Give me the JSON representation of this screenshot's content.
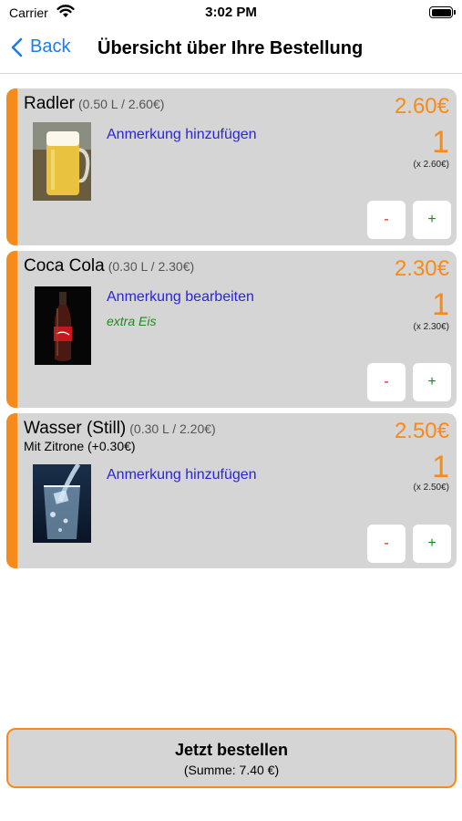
{
  "status_bar": {
    "carrier": "Carrier",
    "time": "3:02 PM"
  },
  "nav": {
    "back_label": "Back",
    "title": "Übersicht über Ihre Bestellung"
  },
  "items": [
    {
      "name": "Radler",
      "meta": "(0.50 L / 2.60€)",
      "extra": "",
      "price": "2.60€",
      "quantity": "1",
      "unit_price": "(x 2.60€)",
      "note_action": "Anmerkung hinzufügen",
      "note_text": "",
      "image": "beer-mug-photo"
    },
    {
      "name": "Coca Cola",
      "meta": "(0.30 L / 2.30€)",
      "extra": "",
      "price": "2.30€",
      "quantity": "1",
      "unit_price": "(x 2.30€)",
      "note_action": "Anmerkung bearbeiten",
      "note_text": "extra Eis",
      "image": "cola-bottle-photo"
    },
    {
      "name": "Wasser (Still)",
      "meta": "(0.30 L / 2.20€)",
      "extra": "Mit Zitrone (+0.30€)",
      "price": "2.50€",
      "quantity": "1",
      "unit_price": "(x 2.50€)",
      "note_action": "Anmerkung hinzufügen",
      "note_text": "",
      "image": "water-glass-photo"
    }
  ],
  "buttons": {
    "minus_label": "-",
    "plus_label": "+"
  },
  "order": {
    "label": "Jetzt bestellen",
    "sum": "(Summe: 7.40 €)"
  },
  "colors": {
    "accent": "#f68a1a",
    "link": "#2a25d8",
    "note": "#1c8a1c",
    "card": "#d5d5d5",
    "ios_blue": "#1a7cf5"
  }
}
